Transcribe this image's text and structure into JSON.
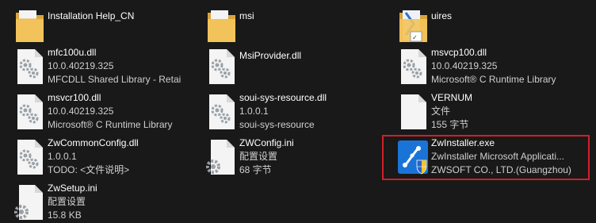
{
  "colors": {
    "background": "#191919",
    "highlight_border": "#d21f2a",
    "folder": "#f3c35b"
  },
  "files": [
    {
      "id": "installation-help-cn",
      "icon": "folder-icon",
      "lines": [
        "Installation Help_CN"
      ]
    },
    {
      "id": "msi",
      "icon": "folder-icon",
      "lines": [
        "msi"
      ]
    },
    {
      "id": "uires",
      "icon": "folder-shortcut-icon",
      "lines": [
        "uires"
      ]
    },
    {
      "id": "mfc100u",
      "icon": "dll-gear-icon",
      "lines": [
        "mfc100u.dll",
        "10.0.40219.325",
        "MFCDLL Shared Library - Retai"
      ]
    },
    {
      "id": "msiprovider",
      "icon": "dll-gear-icon",
      "lines": [
        "MsiProvider.dll"
      ]
    },
    {
      "id": "msvcp100",
      "icon": "dll-gear-icon",
      "lines": [
        "msvcp100.dll",
        "10.0.40219.325",
        "Microsoft® C Runtime Library"
      ]
    },
    {
      "id": "msvcr100",
      "icon": "dll-gear-icon",
      "lines": [
        "msvcr100.dll",
        "10.0.40219.325",
        "Microsoft® C Runtime Library"
      ]
    },
    {
      "id": "soui-sys-resource",
      "icon": "dll-gear-icon",
      "lines": [
        "soui-sys-resource.dll",
        "1.0.0.1",
        "soui-sys-resource"
      ]
    },
    {
      "id": "vernum",
      "icon": "blank-file-icon",
      "lines": [
        "VERNUM",
        "文件",
        "155 字节"
      ]
    },
    {
      "id": "zwcommonconfig",
      "icon": "dll-gear-icon",
      "lines": [
        "ZwCommonConfig.dll",
        "1.0.0.1",
        "TODO: <文件说明>"
      ]
    },
    {
      "id": "zwconfig",
      "icon": "ini-settings-icon",
      "lines": [
        "ZWConfig.ini",
        "配置设置",
        "68 字节"
      ]
    },
    {
      "id": "zwinstaller",
      "icon": "installer-shield-icon",
      "lines": [
        "ZwInstaller.exe",
        "ZwInstaller Microsoft Applicati...",
        "ZWSOFT CO., LTD.(Guangzhou)"
      ]
    },
    {
      "id": "zwsetup",
      "icon": "ini-settings-icon",
      "lines": [
        "ZwSetup.ini",
        "配置设置",
        "15.8 KB"
      ]
    }
  ]
}
